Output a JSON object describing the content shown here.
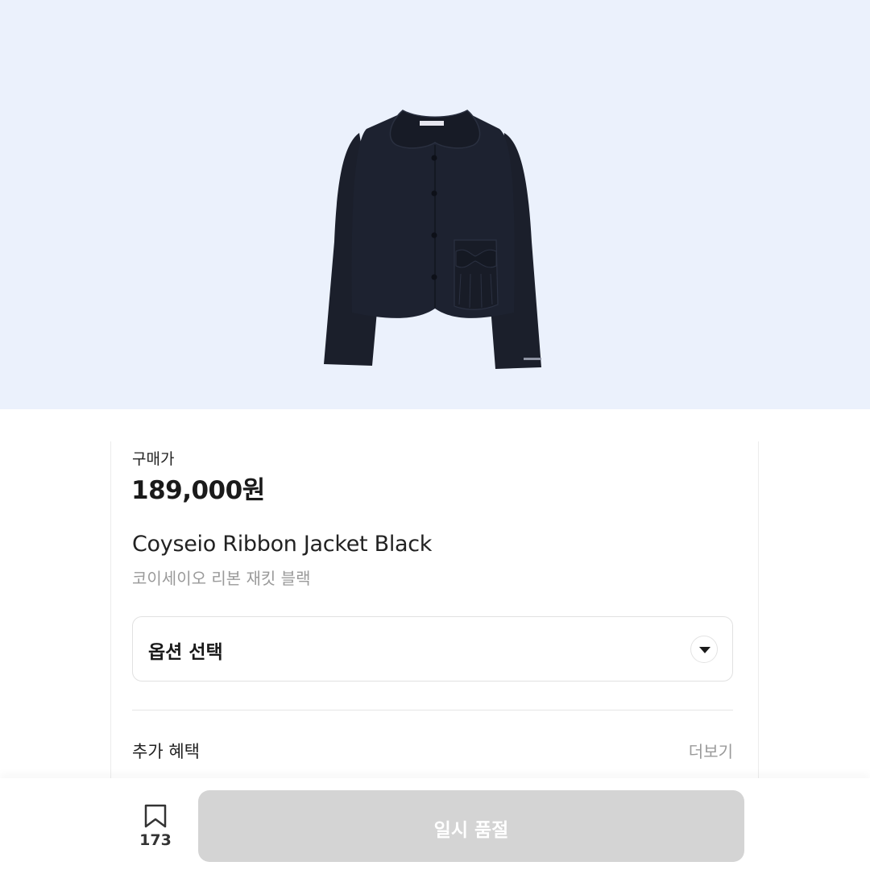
{
  "product": {
    "price_label": "구매가",
    "price": "189,000원",
    "name_en": "Coyseio Ribbon Jacket Black",
    "name_ko": "코이세이오 리본 재킷 블랙"
  },
  "option": {
    "label": "옵션 선택"
  },
  "benefits": {
    "label": "추가 혜택",
    "more_label": "더보기"
  },
  "bottom_bar": {
    "bookmark_count": "173",
    "status_button_label": "일시 품절"
  },
  "colors": {
    "image_background": "#ebf1fc",
    "jacket": "#1a1e2a",
    "disabled_button": "#d4d4d4"
  },
  "icons": {
    "option_toggle": "chevron-down-icon",
    "bookmark": "bookmark-icon"
  }
}
